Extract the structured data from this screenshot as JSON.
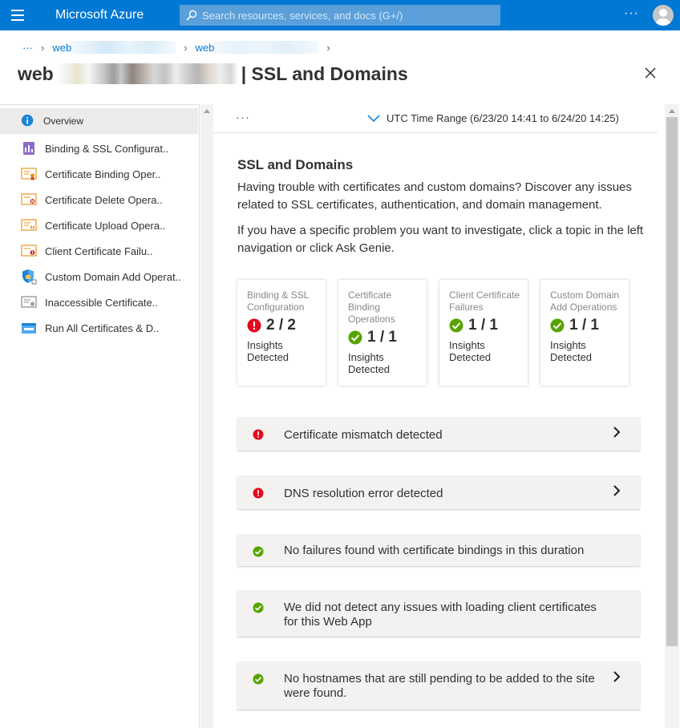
{
  "topbar": {
    "brand": "Microsoft Azure",
    "search_placeholder": "Search resources, services, and docs (G+/)",
    "more": "···"
  },
  "breadcrumb": {
    "more": "···",
    "item1": "web",
    "item2": "web"
  },
  "page": {
    "title_prefix": "web",
    "title": "| SSL and Domains"
  },
  "nav": {
    "items": [
      {
        "label": "Overview",
        "icon": "info-icon"
      },
      {
        "label": "Binding & SSL Configurat..",
        "icon": "binding-icon"
      },
      {
        "label": "Certificate Binding Oper..",
        "icon": "certificate-icon"
      },
      {
        "label": "Certificate Delete Opera..",
        "icon": "certificate-delete-icon"
      },
      {
        "label": "Certificate Upload Opera..",
        "icon": "certificate-upload-icon"
      },
      {
        "label": "Client Certificate Failu..",
        "icon": "certificate-error-icon"
      },
      {
        "label": "Custom Domain Add Operat..",
        "icon": "shield-domain-icon"
      },
      {
        "label": "Inaccessible Certificate..",
        "icon": "certificate-gray-icon"
      },
      {
        "label": "Run All Certificates & D..",
        "icon": "run-all-icon"
      }
    ]
  },
  "toolbar": {
    "more": "···",
    "time_range": "UTC Time Range (6/23/20 14:41 to 6/24/20 14:25)"
  },
  "content": {
    "heading": "SSL and Domains",
    "para1": "Having trouble with certificates and custom domains? Discover any issues related to SSL certificates, authentication, and domain management.",
    "para2": "If you have a specific problem you want to investigate, click a topic in the left navigation or click Ask Genie."
  },
  "cards": [
    {
      "title": "Binding & SSL Configuration",
      "value": "2 / 2",
      "status": "error",
      "sub": "Insights Detected"
    },
    {
      "title": "Certificate Binding Operations",
      "value": "1 / 1",
      "status": "success",
      "sub": "Insights Detected"
    },
    {
      "title": "Client Certificate Failures",
      "value": "1 / 1",
      "status": "success",
      "sub": "Insights Detected"
    },
    {
      "title": "Custom Domain Add Operations",
      "value": "1 / 1",
      "status": "success",
      "sub": "Insights Detected"
    }
  ],
  "insights": [
    {
      "text": "Certificate mismatch detected",
      "status": "error",
      "expandable": true
    },
    {
      "text": "DNS resolution error detected",
      "status": "error",
      "expandable": true
    },
    {
      "text": "No failures found with certificate bindings in this duration",
      "status": "success",
      "expandable": false
    },
    {
      "text": "We did not detect any issues with loading client certificates for this Web App",
      "status": "success",
      "expandable": false
    },
    {
      "text": "No hostnames that are still pending to be added to the site were found.",
      "status": "success",
      "expandable": true
    }
  ],
  "colors": {
    "accent": "#0078d4",
    "error": "#e00b1c",
    "success": "#57a300"
  }
}
